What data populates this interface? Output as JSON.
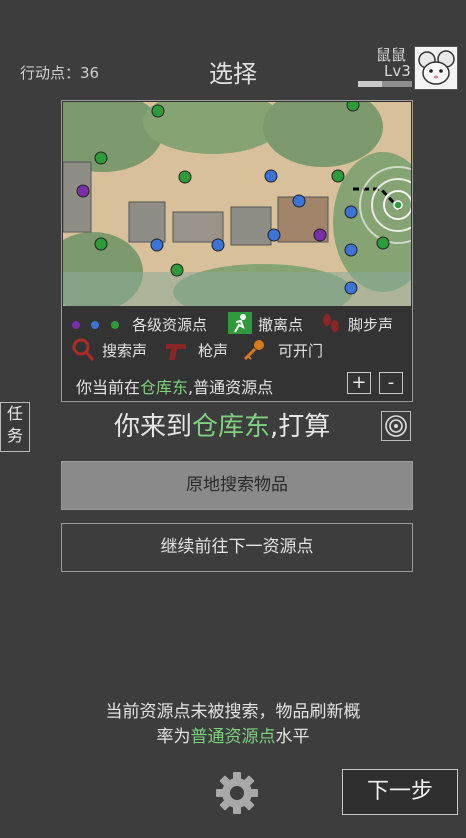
{
  "header": {
    "action_points": "行动点：36",
    "title": "选择",
    "player_name": "鼠鼠",
    "player_level": "Lv3",
    "level_progress": 0.45
  },
  "map": {
    "legend": {
      "resource_points": "各级资源点",
      "evac_point": "撤离点",
      "footsteps": "脚步声",
      "search_sound": "搜索声",
      "gun_sound": "枪声",
      "openable_door": "可开门"
    },
    "location_prefix": "你当前在",
    "location_name": "仓库东",
    "location_suffix": ",普通资源点",
    "zoom_in": "+",
    "zoom_out": "-",
    "colors": {
      "green": "#2f9a3a",
      "blue": "#3b73d6",
      "purple": "#7a2fa8"
    },
    "icons": [
      "evac-runner-icon",
      "footprints-icon",
      "magnifier-icon",
      "pistol-icon",
      "key-icon",
      "radar-icon"
    ]
  },
  "task_button": "任务",
  "arrival": {
    "prefix": "你来到",
    "place": "仓库东",
    "suffix": ",打算"
  },
  "actions": {
    "search": "原地搜索物品",
    "go_next": "继续前往下一资源点"
  },
  "info": {
    "line1": "当前资源点未被搜索，物品刷新概",
    "line2_prefix": "率为",
    "line2_highlight": "普通资源点",
    "line2_suffix": "水平"
  },
  "next_step": "下一步"
}
